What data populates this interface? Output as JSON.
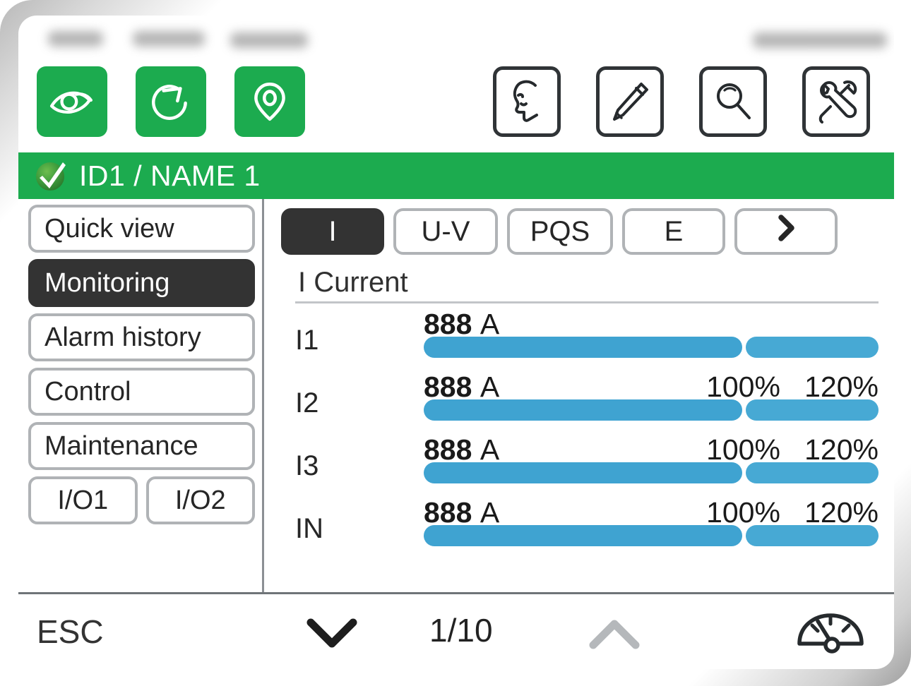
{
  "header": {
    "redacted_left_labels": [
      "",
      "",
      ""
    ],
    "redacted_right_label": ""
  },
  "toolbar_left": [
    {
      "name": "eye-icon",
      "label": "View"
    },
    {
      "name": "refresh-icon",
      "label": "Refresh"
    },
    {
      "name": "location-pin-icon",
      "label": "Location"
    }
  ],
  "toolbar_right": [
    {
      "name": "profile-head-icon",
      "label": "Profile"
    },
    {
      "name": "pencil-icon",
      "label": "Edit"
    },
    {
      "name": "magnifier-icon",
      "label": "Search"
    },
    {
      "name": "tools-icon",
      "label": "Tools"
    }
  ],
  "status": {
    "text": "ID1 / NAME 1",
    "badge": "check-circle-icon",
    "color": "#1CAB4F"
  },
  "sidebar": {
    "items": [
      {
        "label": "Quick view",
        "selected": false
      },
      {
        "label": "Monitoring",
        "selected": true
      },
      {
        "label": "Alarm history",
        "selected": false
      },
      {
        "label": "Control",
        "selected": false
      },
      {
        "label": "Maintenance",
        "selected": false
      }
    ],
    "io": [
      {
        "label": "I/O1"
      },
      {
        "label": "I/O2"
      }
    ]
  },
  "tabs": [
    {
      "label": "I",
      "selected": true
    },
    {
      "label": "U-V",
      "selected": false
    },
    {
      "label": "PQS",
      "selected": false
    },
    {
      "label": "E",
      "selected": false
    },
    {
      "label": "›",
      "selected": false,
      "icon": "chevron-right-icon"
    }
  ],
  "section": {
    "title": "I Current"
  },
  "measurements": {
    "unit": "A",
    "scale_labels": [
      "100%",
      "120%"
    ],
    "rows": [
      {
        "label": "I1",
        "value": "888",
        "unit": "A",
        "show_scale": false,
        "bar_primary_pct": 70,
        "bar_secondary_pct": 30
      },
      {
        "label": "I2",
        "value": "888",
        "unit": "A",
        "show_scale": true,
        "bar_primary_pct": 70,
        "bar_secondary_pct": 30
      },
      {
        "label": "I3",
        "value": "888",
        "unit": "A",
        "show_scale": true,
        "bar_primary_pct": 70,
        "bar_secondary_pct": 30
      },
      {
        "label": "IN",
        "value": "888",
        "unit": "A",
        "show_scale": true,
        "bar_primary_pct": 70,
        "bar_secondary_pct": 30
      }
    ]
  },
  "footer": {
    "esc_label": "ESC",
    "page_indicator": "1/10",
    "down_icon": "chevron-down-icon",
    "up_icon": "chevron-up-icon",
    "gauge_icon": "gauge-icon"
  },
  "colors": {
    "accent_green": "#1CAB4F",
    "bar_blue": "#3FA3D1",
    "selected_dark": "#333333",
    "border_gray": "#b0b3b6"
  }
}
